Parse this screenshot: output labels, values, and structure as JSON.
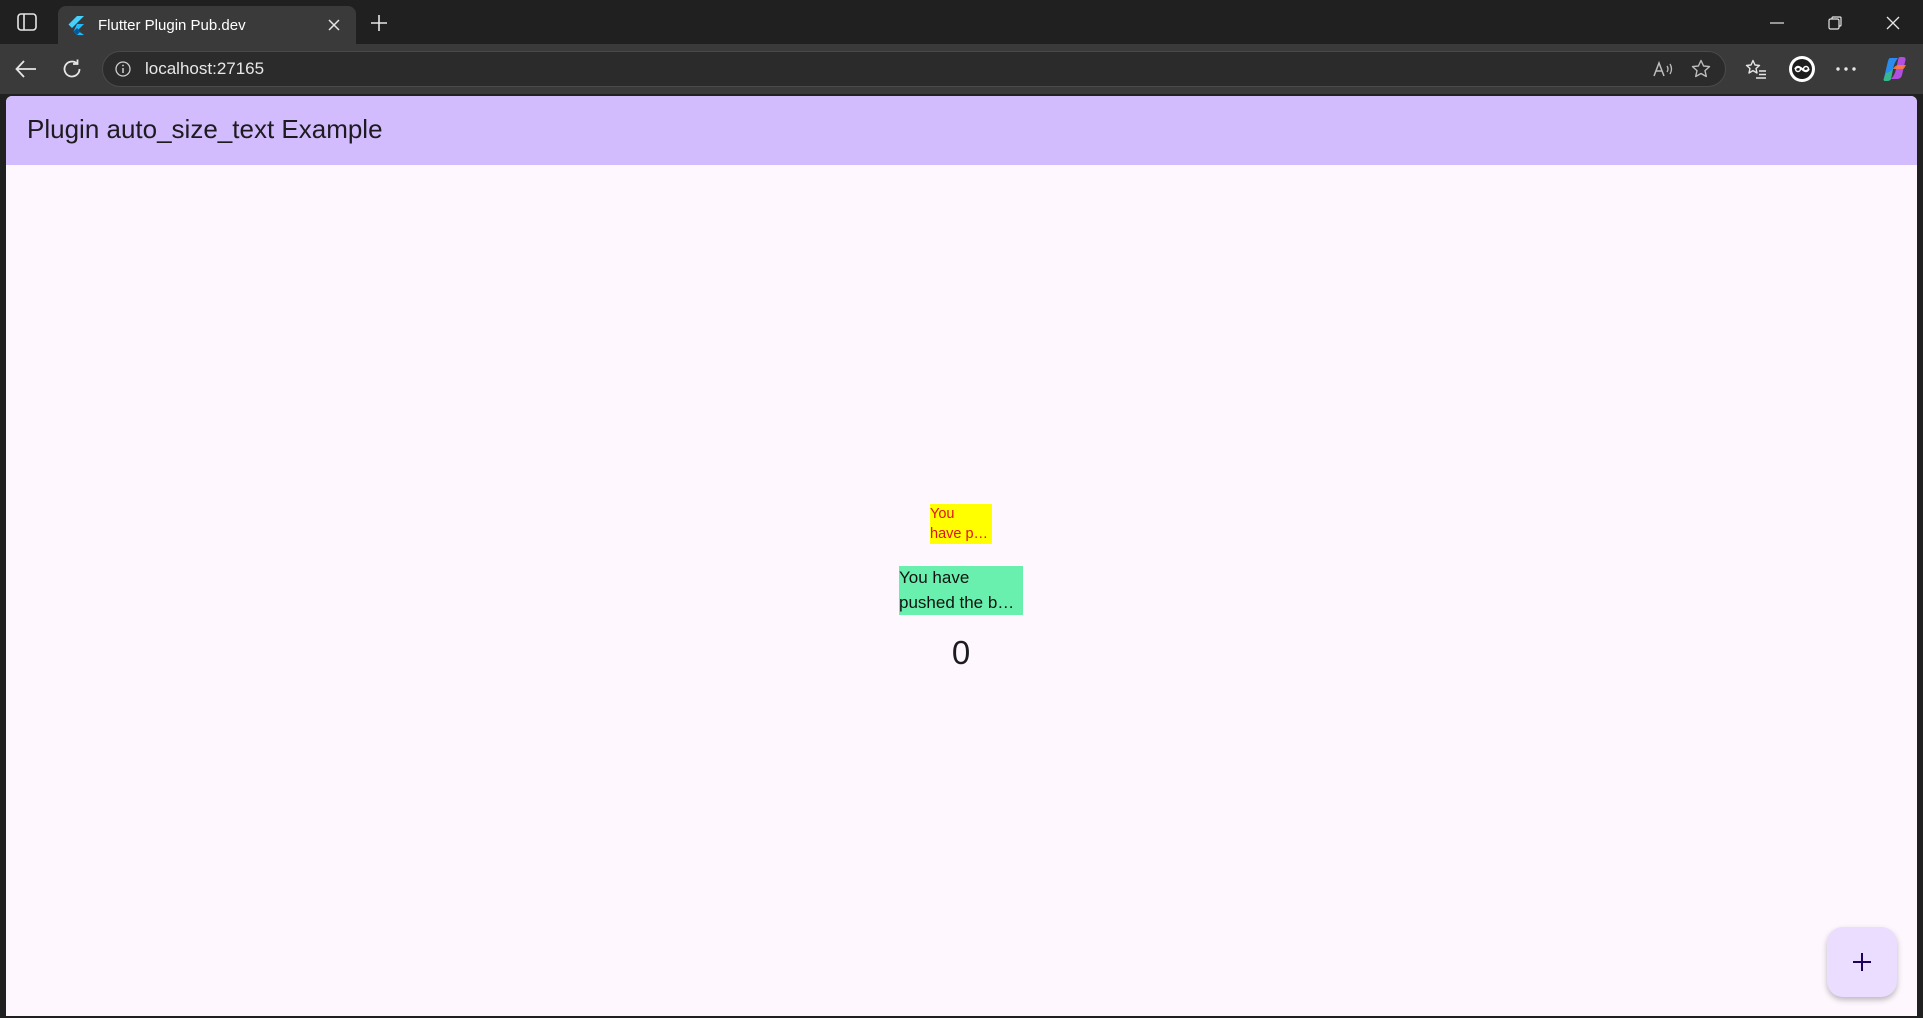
{
  "browser": {
    "tab_title": "Flutter Plugin Pub.dev",
    "url": "localhost:27165"
  },
  "app": {
    "title": "Plugin auto_size_text Example",
    "yellow_text_line1": "You",
    "yellow_text_line2": "have p…",
    "green_text_line1": "You have",
    "green_text_line2": "pushed the b…",
    "counter": "0",
    "fab_label": "+"
  },
  "colors": {
    "appbar": "#d2bcfd",
    "background": "#fef7fe",
    "yellow_box": "#ffff00",
    "yellow_text": "#e0131b",
    "green_box": "#69f0ae",
    "fab": "#eaddff"
  }
}
